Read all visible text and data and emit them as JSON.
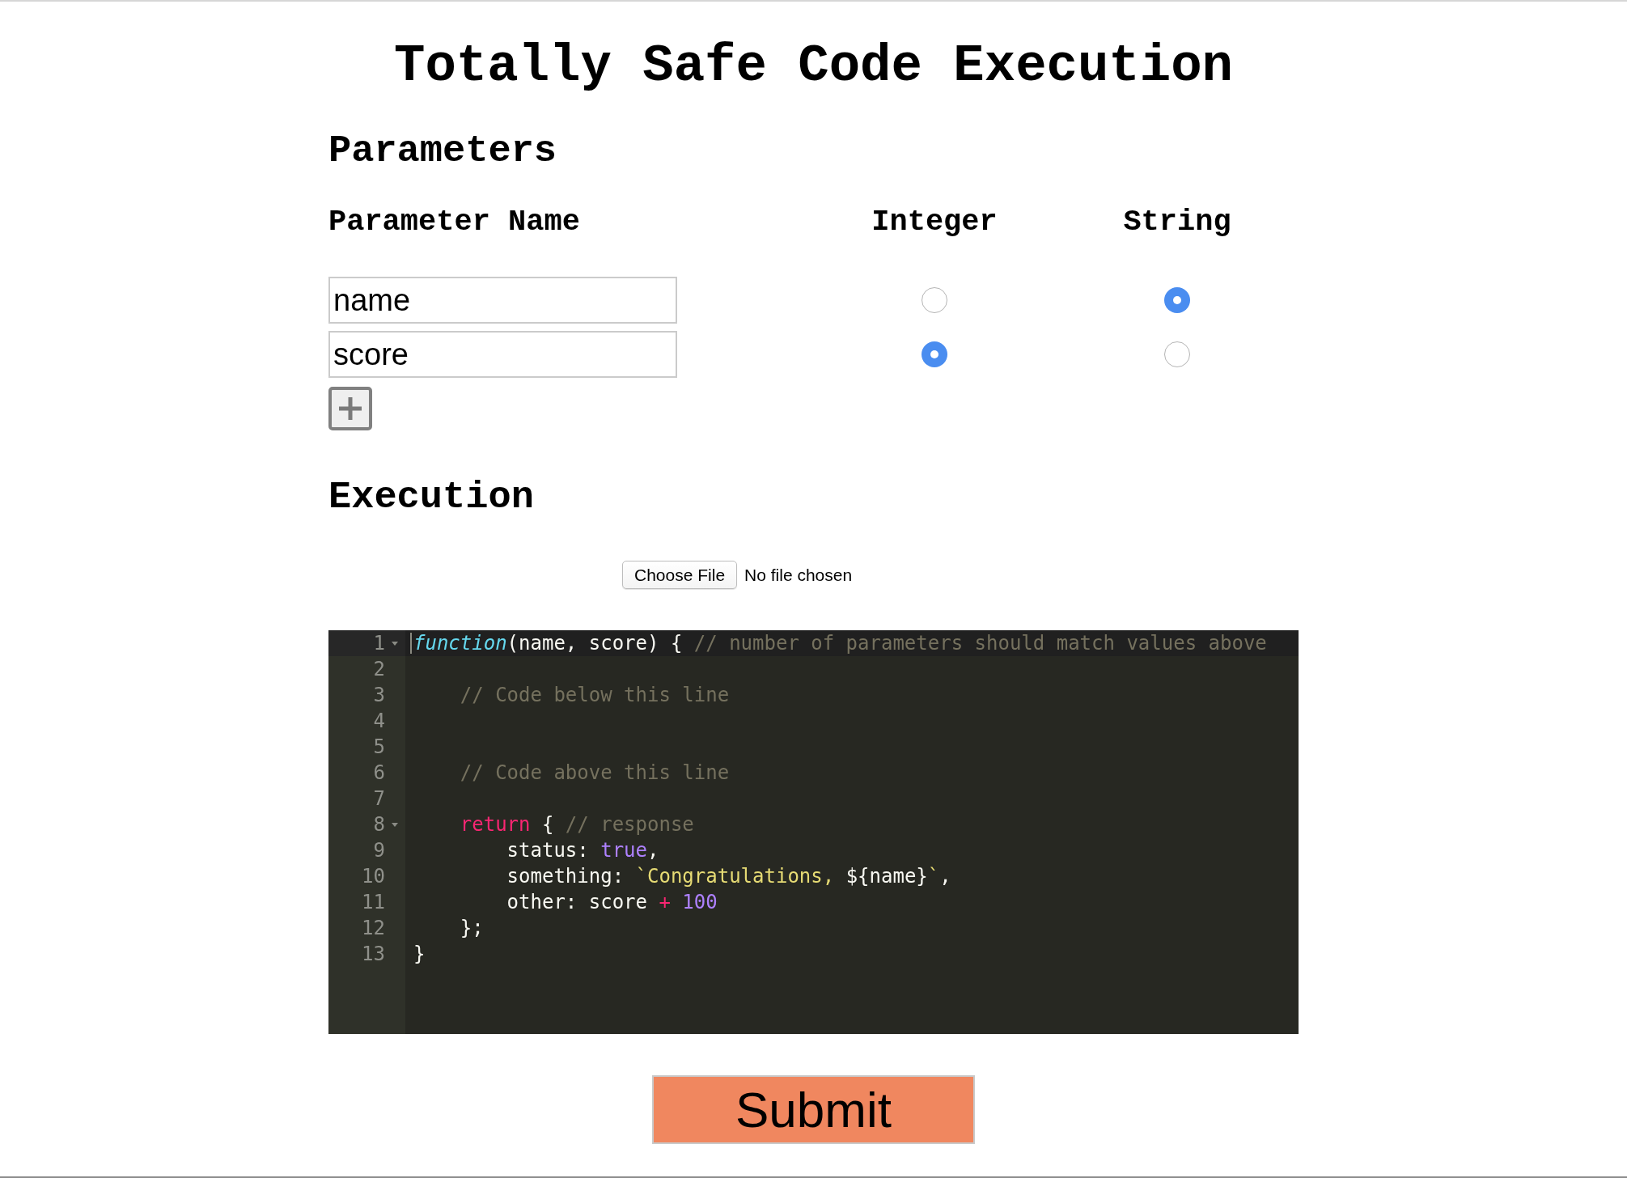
{
  "title": "Totally Safe Code Execution",
  "parameters": {
    "heading": "Parameters",
    "columns": [
      "Parameter Name",
      "Integer",
      "String"
    ],
    "rows": [
      {
        "value": "name",
        "options": [
          {
            "selected": false
          },
          {
            "selected": true
          }
        ]
      },
      {
        "value": "score",
        "options": [
          {
            "selected": true
          },
          {
            "selected": false
          }
        ]
      }
    ]
  },
  "execution": {
    "heading": "Execution",
    "file_input": {
      "button": "Choose File",
      "status": "No file chosen"
    },
    "editor": {
      "lines": [
        {
          "number": "1",
          "active": true,
          "foldable": true,
          "tokens": [
            {
              "kind": "storage",
              "text": "function"
            },
            {
              "kind": "plain",
              "text": "(name, score) { "
            },
            {
              "kind": "comment",
              "text": "// number of parameters should match values above"
            }
          ]
        },
        {
          "number": "2",
          "active": false,
          "foldable": false
        },
        {
          "number": "3",
          "active": false,
          "foldable": false,
          "tokens": [
            {
              "kind": "comment",
              "text": "    // Code below this line"
            }
          ]
        },
        {
          "number": "4",
          "active": false,
          "foldable": false
        },
        {
          "number": "5",
          "active": false,
          "foldable": false
        },
        {
          "number": "6",
          "active": false,
          "foldable": false,
          "tokens": [
            {
              "kind": "comment",
              "text": "    // Code above this line"
            }
          ]
        },
        {
          "number": "7",
          "active": false,
          "foldable": false
        },
        {
          "number": "8",
          "active": false,
          "foldable": true,
          "tokens": [
            {
              "kind": "keyword",
              "text": "    return"
            },
            {
              "kind": "plain",
              "text": " { "
            },
            {
              "kind": "comment",
              "text": "// response"
            }
          ]
        },
        {
          "number": "9",
          "active": false,
          "foldable": false,
          "tokens": [
            {
              "kind": "plain",
              "text": "        status: "
            },
            {
              "kind": "constant",
              "text": "true"
            },
            {
              "kind": "plain",
              "text": ","
            }
          ]
        },
        {
          "number": "10",
          "active": false,
          "foldable": false,
          "tokens": [
            {
              "kind": "plain",
              "text": "        something: "
            },
            {
              "kind": "string",
              "text": "`Congratulations, "
            },
            {
              "kind": "plain",
              "text": "${name}"
            },
            {
              "kind": "string",
              "text": "`"
            },
            {
              "kind": "plain",
              "text": ","
            }
          ]
        },
        {
          "number": "11",
          "active": false,
          "foldable": false,
          "tokens": [
            {
              "kind": "plain",
              "text": "        other: score "
            },
            {
              "kind": "keyword",
              "text": "+"
            },
            {
              "kind": "constant",
              "text": " 100"
            }
          ]
        },
        {
          "number": "12",
          "active": false,
          "foldable": false,
          "tokens": [
            {
              "kind": "plain",
              "text": "    };"
            }
          ]
        },
        {
          "number": "13",
          "active": false,
          "foldable": false,
          "tokens": [
            {
              "kind": "plain",
              "text": "}"
            }
          ]
        }
      ]
    }
  },
  "submit_button": "Submit"
}
